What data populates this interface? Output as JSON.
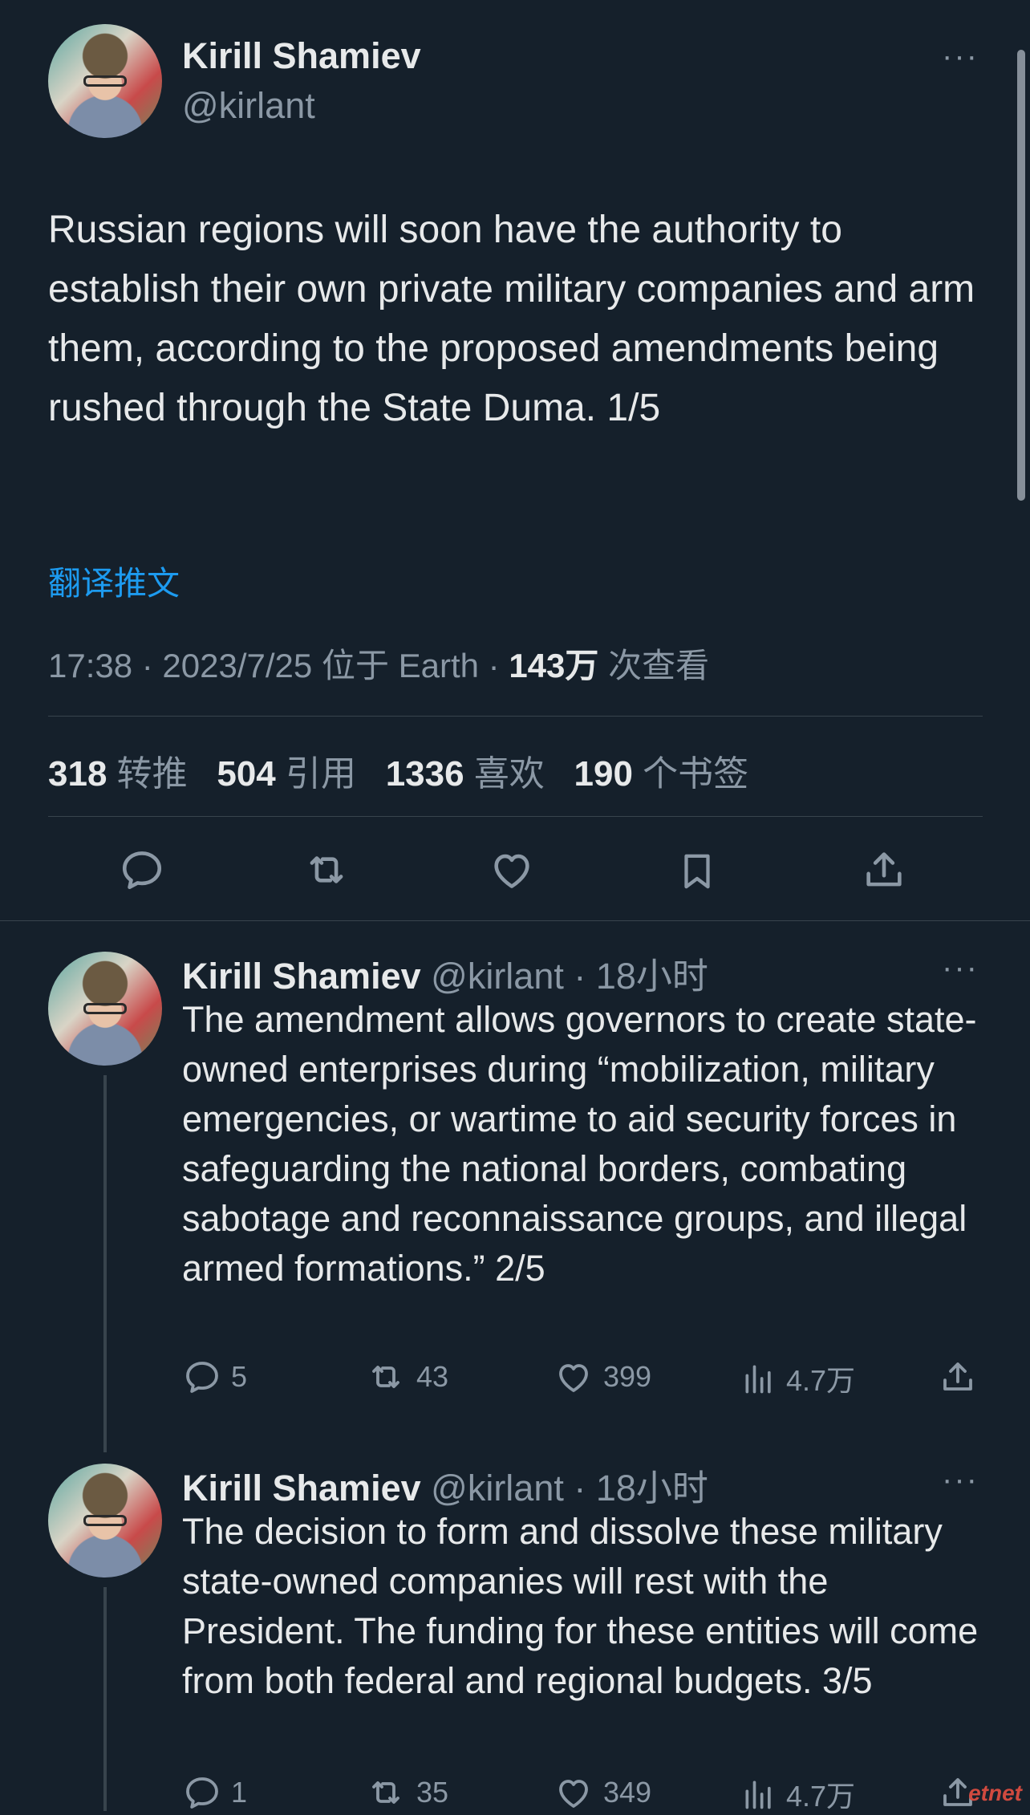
{
  "main_tweet": {
    "author_name": "Kirill Shamiev",
    "author_handle": "@kirlant",
    "more": "···",
    "text": "Russian regions will soon have the authority to establish their own private military companies and arm them, according to the proposed amendments being rushed through the State Duma. 1/5",
    "translate_link": "翻译推文",
    "meta_time": "17:38 · 2023/7/25 位于 Earth · ",
    "views_num": "143万",
    "views_label": " 次查看",
    "stats": [
      {
        "num": "318",
        "label": "转推"
      },
      {
        "num": "504",
        "label": "引用"
      },
      {
        "num": "1336",
        "label": "喜欢"
      },
      {
        "num": "190",
        "label": "个书签"
      }
    ]
  },
  "replies": [
    {
      "author_name": "Kirill Shamiev",
      "handle_time": "@kirlant · 18小时",
      "more": "···",
      "text": "The amendment allows governors to create state-owned enterprises during “mobilization, military emergencies, or wartime to aid security forces in safeguarding the national borders, combating sabotage and reconnaissance groups, and illegal armed formations.” 2/5",
      "reply_count": "5",
      "retweet_count": "43",
      "like_count": "399",
      "views_count": "4.7万"
    },
    {
      "author_name": "Kirill Shamiev",
      "handle_time": "@kirlant · 18小时",
      "more": "···",
      "text": "The decision to form and dissolve these military state-owned companies will rest with the President. The funding for these entities will come from both federal and regional budgets. 3/5",
      "reply_count": "1",
      "retweet_count": "35",
      "like_count": "349",
      "views_count": "4.7万"
    }
  ],
  "colors": {
    "background": "#15202b",
    "text": "#e7e9ea",
    "secondary": "#8b98a5",
    "link": "#1d9bf0",
    "divider": "#38444d"
  },
  "watermark": "etnet"
}
